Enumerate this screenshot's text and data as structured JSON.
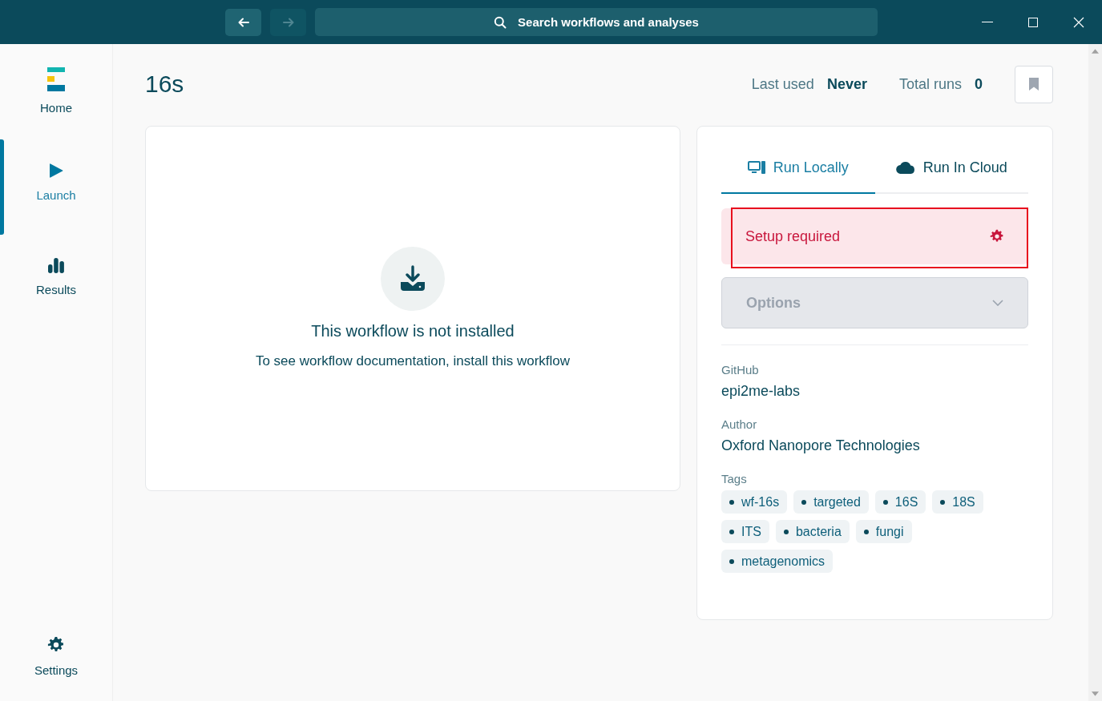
{
  "titlebar": {
    "search_label": "Search workflows and analyses",
    "back_disabled": false,
    "forward_disabled": true
  },
  "sidebar": {
    "items": [
      {
        "label": "Home",
        "kind": "logo",
        "selected": false
      },
      {
        "label": "Launch",
        "kind": "play",
        "selected": true
      },
      {
        "label": "Results",
        "kind": "bars",
        "selected": false
      }
    ],
    "footer": {
      "label": "Settings"
    }
  },
  "workflow": {
    "title": "16s",
    "stats": [
      {
        "label": "Last used",
        "value": "Never"
      },
      {
        "label": "Total runs",
        "value": "0"
      }
    ]
  },
  "empty_state": {
    "heading": "This workflow is not installed",
    "message": "To see workflow documentation, install this workflow"
  },
  "run_panel": {
    "tabs": [
      {
        "label": "Run Locally",
        "kind": "computer",
        "selected": true
      },
      {
        "label": "Run In Cloud",
        "kind": "cloud",
        "selected": false
      }
    ],
    "alert": {
      "text": "Setup required",
      "highlighted": true
    },
    "options": {
      "label": "Options",
      "disabled": true
    },
    "meta": [
      {
        "label": "GitHub",
        "value": "epi2me-labs"
      },
      {
        "label": "Author",
        "value": "Oxford Nanopore Technologies"
      }
    ],
    "tags_label": "Tags",
    "tags": [
      "wf-16s",
      "targeted",
      "16S",
      "18S",
      "ITS",
      "bacteria",
      "fungi",
      "metagenomics"
    ]
  }
}
